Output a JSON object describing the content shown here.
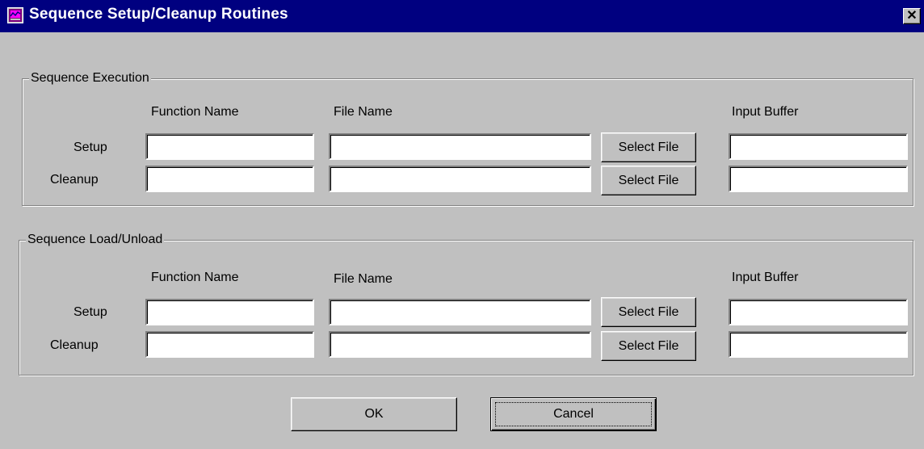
{
  "window": {
    "title": "Sequence Setup/Cleanup Routines",
    "close_label": "✕"
  },
  "execution": {
    "group_label": "Sequence Execution",
    "headers": {
      "function_name": "Function Name",
      "file_name": "File Name",
      "input_buffer": "Input Buffer"
    },
    "setup": {
      "label": "Setup",
      "function_name": "",
      "file_name": "",
      "button": "Select File",
      "input_buffer": ""
    },
    "cleanup": {
      "label": "Cleanup",
      "function_name": "",
      "file_name": "",
      "button": "Select File",
      "input_buffer": ""
    }
  },
  "load_unload": {
    "group_label": "Sequence Load/Unload",
    "headers": {
      "function_name": "Function Name",
      "file_name": "File Name",
      "input_buffer": "Input Buffer"
    },
    "setup": {
      "label": "Setup",
      "function_name": "",
      "file_name": "",
      "button": "Select File",
      "input_buffer": ""
    },
    "cleanup": {
      "label": "Cleanup",
      "function_name": "",
      "file_name": "",
      "button": "Select File",
      "input_buffer": ""
    }
  },
  "footer": {
    "ok_label": "OK",
    "cancel_label": "Cancel"
  },
  "colors": {
    "face": "#c0c0c0",
    "titlebar": "#000080",
    "title_text": "#ffffff"
  }
}
